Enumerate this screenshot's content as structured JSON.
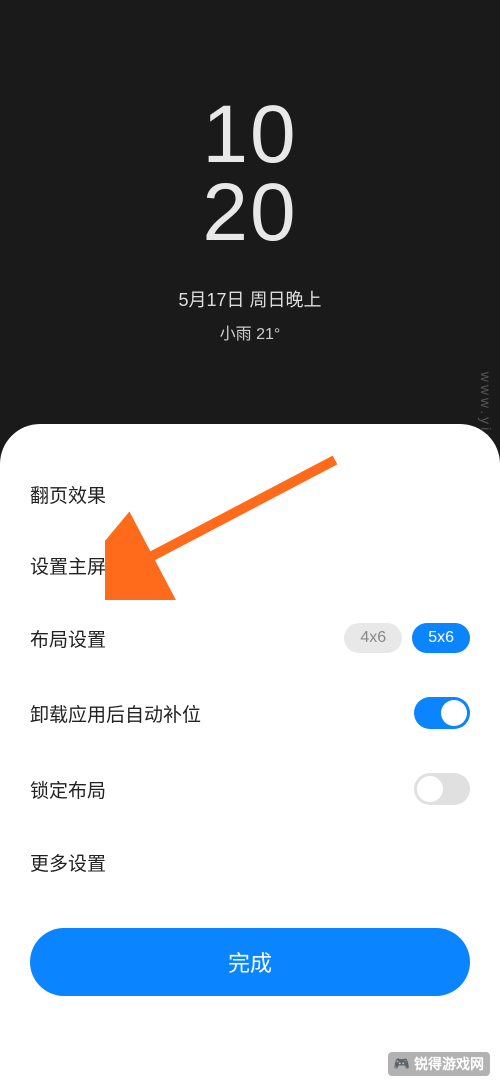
{
  "preview": {
    "clock_top": "10",
    "clock_bottom": "20",
    "date": "5月17日 周日晚上",
    "weather": "小雨  21°"
  },
  "settings": {
    "page_effect": "翻页效果",
    "set_home": "设置主屏",
    "layout": {
      "label": "布局设置",
      "opt1": "4x6",
      "opt2": "5x6"
    },
    "auto_fill": "卸载应用后自动补位",
    "lock_layout": "锁定布局",
    "more": "更多设置"
  },
  "done_label": "完成",
  "watermark_bottom": "锐得游戏网",
  "watermark_side": "www.yiruida.c"
}
